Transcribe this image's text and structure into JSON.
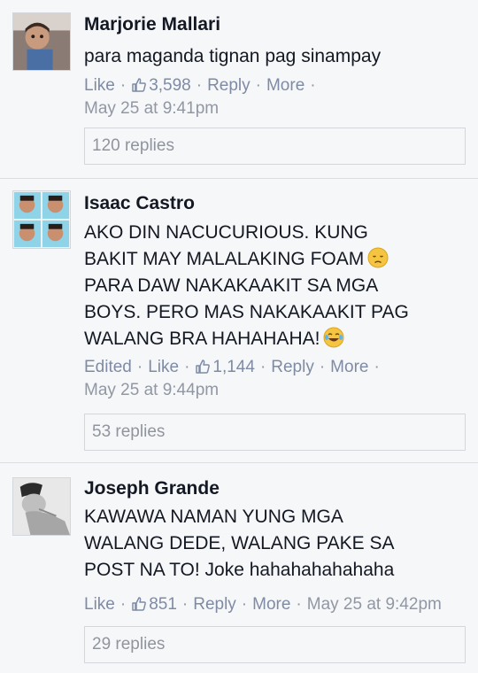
{
  "comments": [
    {
      "author": "Marjorie Mallari",
      "text_lines": [
        "para maganda tignan pag sinampay"
      ],
      "edited_label": "",
      "like_label": "Like",
      "likes_count": "3,598",
      "reply_label": "Reply",
      "more_label": "More",
      "timestamp": "May 25 at 9:41pm",
      "replies_label": "120 replies"
    },
    {
      "author": "Isaac Castro",
      "text_lines": [
        "AKO DIN NACUCURIOUS. KUNG",
        "BAKIT MAY MALALAKING FOAM",
        "PARA DAW NAKAKAAKIT SA MGA",
        "BOYS. PERO MAS NAKAKAAKIT PAG",
        "WALANG BRA HAHAHAHA!"
      ],
      "edited_label": "Edited",
      "like_label": "Like",
      "likes_count": "1,144",
      "reply_label": "Reply",
      "more_label": "More",
      "timestamp": "May 25 at 9:44pm",
      "replies_label": "53 replies",
      "emoji_names": [
        "disappointed-face-icon",
        "tears-of-joy-face-icon"
      ]
    },
    {
      "author": "Joseph Grande",
      "text_lines": [
        "KAWAWA NAMAN YUNG MGA",
        "WALANG DEDE, WALANG PAKE SA",
        "POST NA TO! Joke hahahahahahaha"
      ],
      "edited_label": "",
      "like_label": "Like",
      "likes_count": "851",
      "reply_label": "Reply",
      "more_label": "More",
      "timestamp": "May 25 at 9:42pm",
      "replies_label": "29 replies"
    }
  ],
  "colors": {
    "background": "#f6f7f9",
    "link": "#7f8ba4",
    "meta": "#9197a3",
    "text": "#141823",
    "border": "#d3d6db"
  }
}
